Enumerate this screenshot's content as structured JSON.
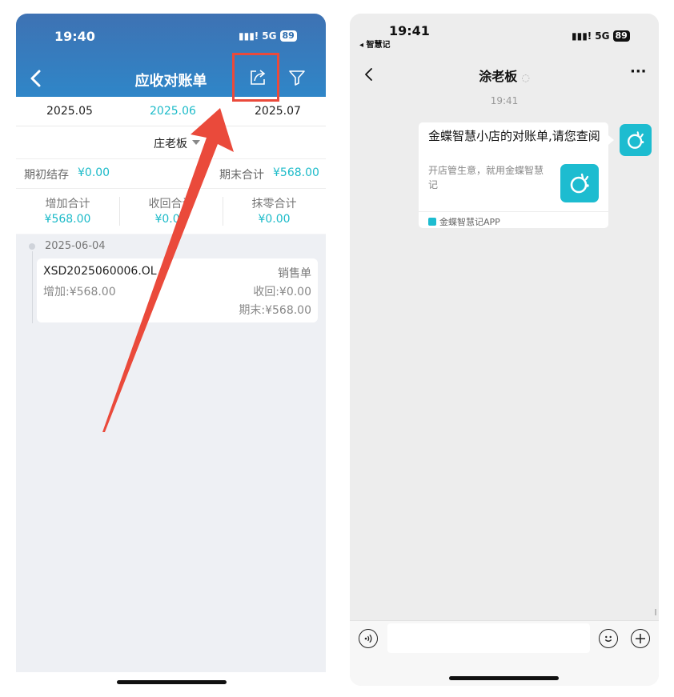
{
  "left": {
    "status": {
      "time": "19:40",
      "network": "5G",
      "battery": "89"
    },
    "nav": {
      "title": "应收对账单"
    },
    "months": [
      "2025.05",
      "2025.06",
      "2025.07"
    ],
    "filter": {
      "customer": "庄老板"
    },
    "summary": {
      "opening_label": "期初结存",
      "opening_value": "¥0.00",
      "closing_label": "期末合计",
      "closing_value": "¥568.00"
    },
    "totals": [
      {
        "label": "增加合计",
        "value": "¥568.00"
      },
      {
        "label": "收回合计",
        "value": "¥0.00"
      },
      {
        "label": "抹零合计",
        "value": "¥0.00"
      }
    ],
    "entries": [
      {
        "date": "2025-06-04",
        "doc_no": "XSD2025060006.OL",
        "type": "销售单",
        "increase": "增加:¥568.00",
        "received": "收回:¥0.00",
        "closing": "期末:¥568.00"
      }
    ]
  },
  "right": {
    "status": {
      "time": "19:41",
      "back_app": "◂ 智慧记",
      "network": "5G",
      "battery": "89"
    },
    "nav": {
      "title": "涂老板",
      "more": "···"
    },
    "chat": {
      "timestamp": "19:41",
      "card_title": "金蝶智慧小店的对账单,请您查阅",
      "card_desc": "开店管生意，就用金蝶智慧记",
      "card_source": "金蝶智慧记APP"
    }
  },
  "colors": {
    "accent": "#1dbbc9",
    "header_blue": "#3475b9",
    "annotation_red": "#ea4a3b"
  }
}
